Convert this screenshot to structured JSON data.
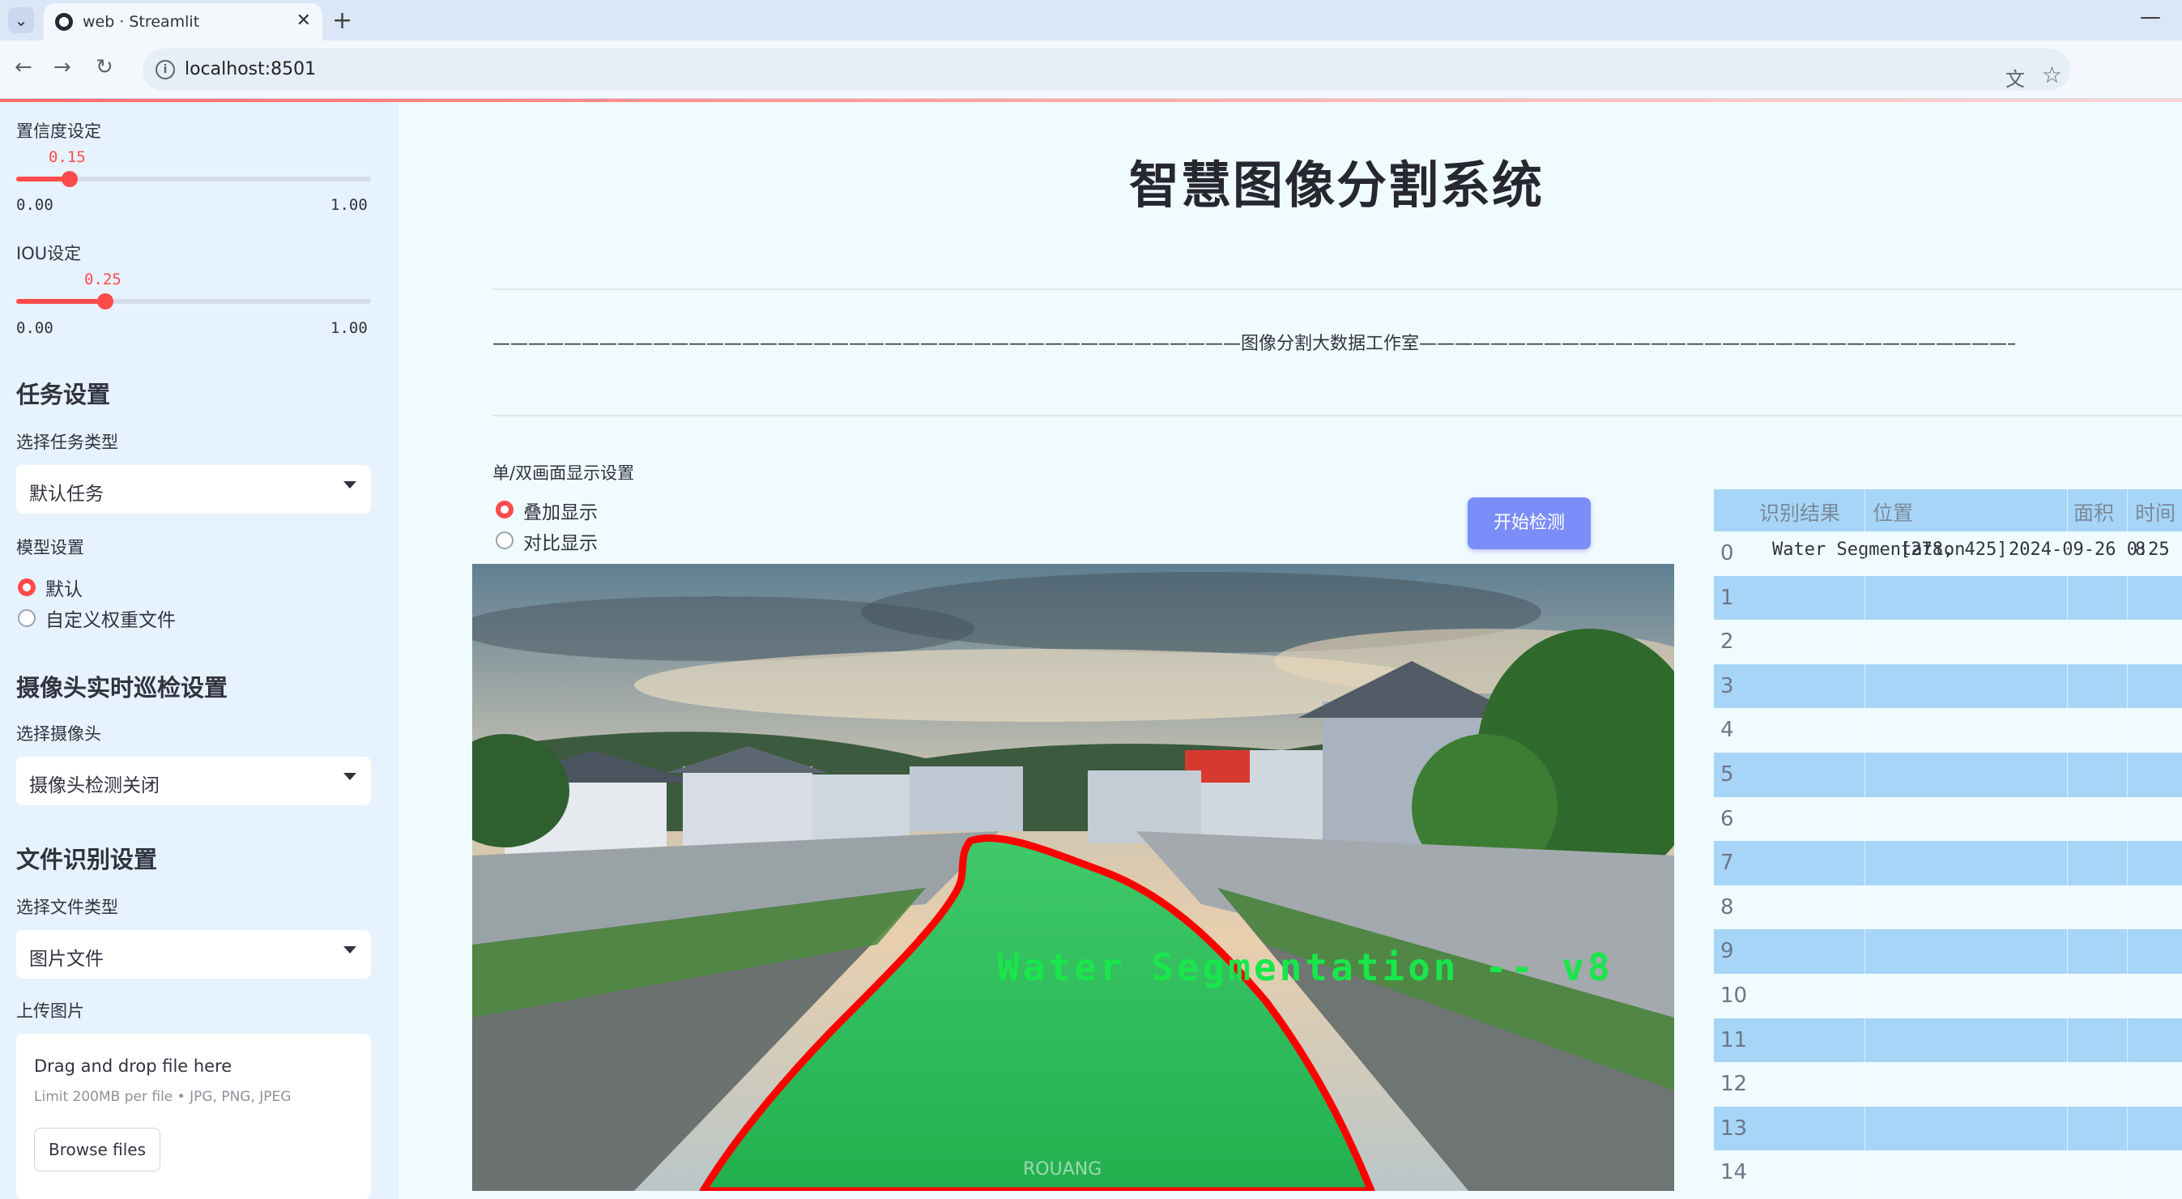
{
  "browser": {
    "tab_title": "web · Streamlit",
    "url": "localhost:8501"
  },
  "sidebar": {
    "confidence": {
      "label": "置信度设定",
      "value": 0.15,
      "value_text": "0.15",
      "min": "0.00",
      "max": "1.00"
    },
    "iou": {
      "label": "IOU设定",
      "value": 0.25,
      "value_text": "0.25",
      "min": "0.00",
      "max": "1.00"
    },
    "task_heading": "任务设置",
    "task_type_label": "选择任务类型",
    "task_type_value": "默认任务",
    "model_label": "模型设置",
    "model_options": [
      "默认",
      "自定义权重文件"
    ],
    "camera_heading": "摄像头实时巡检设置",
    "camera_label": "选择摄像头",
    "camera_value": "摄像头检测关闭",
    "file_heading": "文件识别设置",
    "file_type_label": "选择文件类型",
    "file_type_value": "图片文件",
    "upload_label": "上传图片",
    "uploader": {
      "title": "Drag and drop file here",
      "limit": "Limit 200MB per file • JPG, PNG, JPEG",
      "button": "Browse files"
    }
  },
  "main": {
    "title": "智慧图像分割系统",
    "subtitle": "——————————————————————————————————————————图像分割大数据工作室——————————————————————————————————————————",
    "display_mode_label": "单/双画面显示设置",
    "display_modes": [
      "叠加显示",
      "对比显示"
    ],
    "start_button": "开始检测",
    "overlay_text": "Water Segmentation -- v8",
    "watermark": "ROUANG"
  },
  "colors": {
    "accent": "#ff4b4b",
    "button": "#7b8df8",
    "table_stripe": "#a6d5f8",
    "segmentation_fill": "#2fd65a",
    "segmentation_outline": "#ff0000"
  },
  "table": {
    "columns": [
      "识别结果",
      "位置",
      "面积",
      "时间"
    ],
    "rows": [
      {
        "index": "0",
        "result": "Water Segmentation",
        "position": "[278, 425]",
        "area": "8",
        "time": "2024-09-26 0:25"
      },
      {
        "index": "1"
      },
      {
        "index": "2"
      },
      {
        "index": "3"
      },
      {
        "index": "4"
      },
      {
        "index": "5"
      },
      {
        "index": "6"
      },
      {
        "index": "7"
      },
      {
        "index": "8"
      },
      {
        "index": "9"
      },
      {
        "index": "10"
      },
      {
        "index": "11"
      },
      {
        "index": "12"
      },
      {
        "index": "13"
      },
      {
        "index": "14"
      }
    ]
  }
}
